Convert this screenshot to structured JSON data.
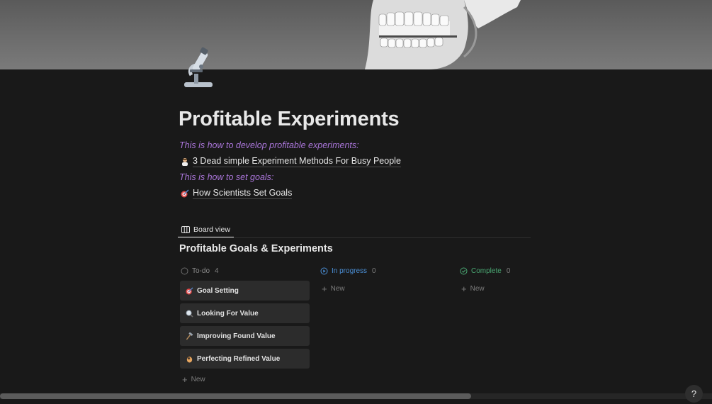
{
  "page": {
    "title": "Profitable Experiments",
    "cover_icon": "skull-jaw-image",
    "page_icon": "microscope-icon"
  },
  "intro": [
    {
      "type": "italic",
      "text": "This is how to develop profitable experiments:"
    },
    {
      "type": "link",
      "icon": "scientist-icon",
      "text": "3 Dead simple Experiment Methods For Busy People"
    },
    {
      "type": "italic",
      "text": "This is how to set goals:"
    },
    {
      "type": "link",
      "icon": "dart-target-icon",
      "text": "How Scientists Set Goals"
    }
  ],
  "view_tab": {
    "label": "Board view",
    "icon": "board-view-icon"
  },
  "database": {
    "title": "Profitable Goals & Experiments",
    "columns": [
      {
        "label": "To-do",
        "count": "4",
        "color": "#8a8a8a",
        "status_icon": "empty-circle-icon",
        "cards": [
          {
            "icon": "dart-target-icon",
            "label": "Goal Setting"
          },
          {
            "icon": "magnifier-icon",
            "label": "Looking For Value"
          },
          {
            "icon": "hammer-icon",
            "label": "Improving Found Value"
          },
          {
            "icon": "ok-hand-icon",
            "label": "Perfecting Refined Value"
          }
        ],
        "new_label": "New"
      },
      {
        "label": "In progress",
        "count": "0",
        "color": "#4b8fd6",
        "status_icon": "play-circle-icon",
        "cards": [],
        "new_label": "New"
      },
      {
        "label": "Complete",
        "count": "0",
        "color": "#4aa873",
        "status_icon": "check-circle-icon",
        "cards": [],
        "new_label": "New"
      }
    ]
  },
  "help_label": "?"
}
